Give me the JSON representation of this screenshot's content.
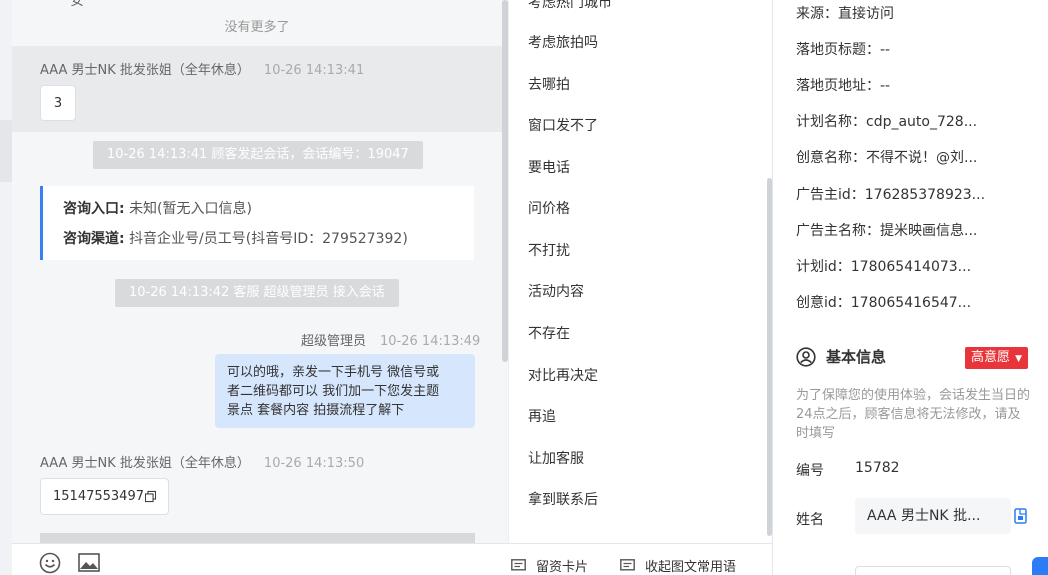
{
  "chat": {
    "no_more": "没有更多了",
    "top_sliver": "安",
    "messages": [
      {
        "sender": "AAA 男士NK 批发张姐（全年休息）",
        "time": "10-26 14:13:41",
        "content": "3"
      },
      {
        "sender": "AAA 男士NK 批发张姐（全年休息）",
        "time": "10-26 14:13:50",
        "content": "15147553497"
      }
    ],
    "system_1": "10-26 14:13:41 顾客发起会话，会话编号：19047",
    "system_2": "10-26 14:13:42 客服 超级管理员 接入会话",
    "info_card": {
      "entry_label": "咨询入口:",
      "entry_value": "未知(暂无入口信息)",
      "channel_label": "咨询渠道:",
      "channel_value": "抖音企业号/员工号(抖音号ID：279527392)"
    },
    "agent_reply": {
      "sender": "超级管理员",
      "time": "10-26 14:13:49",
      "lines": [
        "可以的哦，亲发一下手机号 微信号或",
        "者二维码都可以 我们加一下您发主题",
        "景点 套餐内容 拍摄流程了解下"
      ]
    }
  },
  "phrases": {
    "partial_top": "考虑热门城市",
    "items": [
      "考虑旅拍吗",
      "去哪拍",
      "窗口发不了",
      "要电话",
      "问价格",
      "不打扰",
      "活动内容",
      "不存在",
      "对比再决定",
      "再追",
      "让加客服",
      "拿到联系后"
    ],
    "bottom": {
      "card_label": "留资卡片",
      "collapse_label": "收起图文常用语"
    }
  },
  "details": {
    "rows": [
      "来源：直接访问",
      "落地页标题：--",
      "落地页地址：--",
      "计划名称：cdp_auto_728...",
      "创意名称：不得不说！@刘...",
      "广告主id：176285378923...",
      "广告主名称：提米映画信息...",
      "计划id：178065414073...",
      "创意id：178065416547..."
    ],
    "basic_info_title": "基本信息",
    "intent_badge": "高意愿",
    "note": "为了保障您的使用体验，会话发生当日的24点之后，顾客信息将无法修改，请及时填写",
    "id_label": "编号",
    "id_value": "15782",
    "name_label": "姓名",
    "name_value": "AAA 男士NK 批..."
  }
}
